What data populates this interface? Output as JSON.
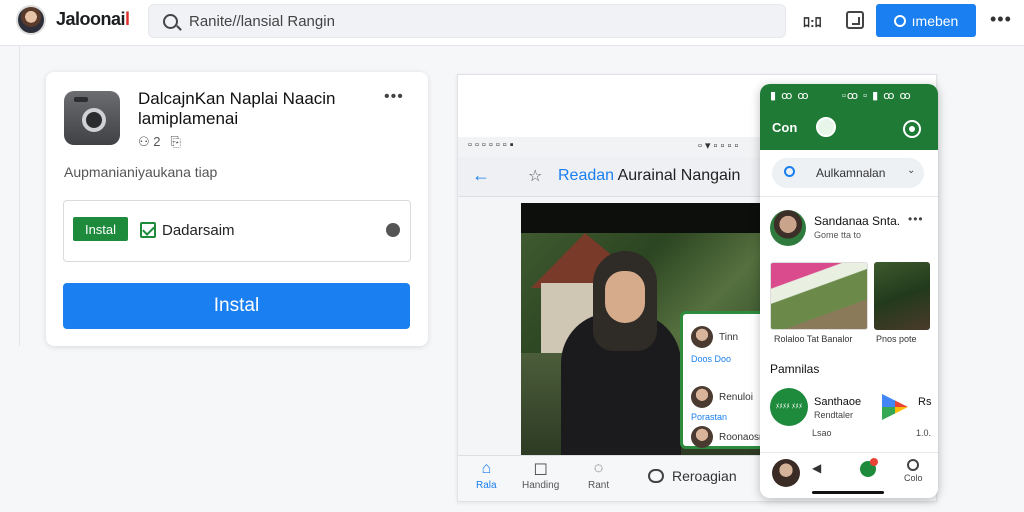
{
  "topbar": {
    "brand_main": "Jaloonai",
    "brand_suffix": "l",
    "search_placeholder": "Ranite//lansial Rangin",
    "counter_text": "ﾛ:ﾛ",
    "member_label": "ımeben"
  },
  "card": {
    "title": "DalcajnKan Naplai Naacin lamiplamenai",
    "meta_count": "2",
    "desc": "Aupmanianiyaukana tiap",
    "small_install_label": "Instal",
    "option_label": "Dadarsaim",
    "install_label": "Instal"
  },
  "browser": {
    "status_left": "▫ ▫ ▫ ▫ ▫ ▫ ▪",
    "status_right": "▫ ▾ ▫ ▫ ▫ ▫",
    "title_prefix": "Readan",
    "title_rest": " Aurainal Nangain",
    "overlay": {
      "row1": "Tinn",
      "sub1": "Doos Doo",
      "row2": "Renuloi",
      "sub2": "Porastan",
      "row3": "Roonaosra"
    },
    "bottom_nav": [
      {
        "label": "Rala"
      },
      {
        "label": "Handing"
      },
      {
        "label": "Rant"
      }
    ],
    "message_label": "Reroagian"
  },
  "phone": {
    "status_left": "▮ ꝏ ꝏ",
    "status_right": "▫ꝏ ▫ ▮ ꝏ ꝏ",
    "logo_text": "Con",
    "search_text": "Aulkamnalan",
    "post_name": "Sandanaa Snta.",
    "post_sub": "Gome tta to",
    "caption_left": "Rolaloo Tat Banalor",
    "caption_right": "Pnos pote",
    "section_title": "Pamnilas",
    "green_badge": "ﾒﾒﾒﾒ ﾒﾒﾒ",
    "item_title": "Santhaoe",
    "item_sub": "Rendtaler",
    "item_right": "Rs",
    "foot_left": "Lsao",
    "foot_right": "1.0.",
    "nav_profile": "Colo"
  },
  "colors": {
    "primary_blue": "#1a7ff0",
    "install_green": "#1e8a3c",
    "phone_header_green": "#1e7a34"
  }
}
